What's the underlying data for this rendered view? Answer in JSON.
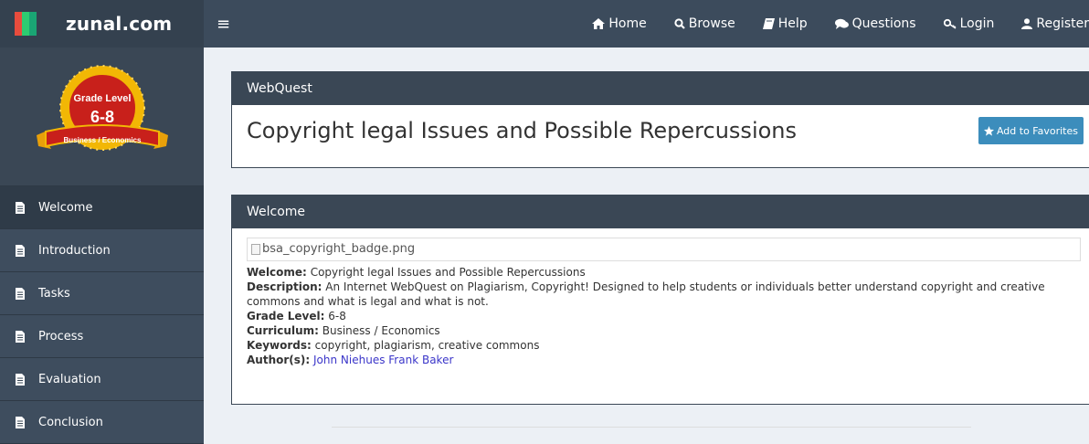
{
  "brand": {
    "name": "zunal.com"
  },
  "nav": [
    {
      "label": "Home",
      "icon": "home-icon"
    },
    {
      "label": "Browse",
      "icon": "search-icon"
    },
    {
      "label": "Help",
      "icon": "book-icon"
    },
    {
      "label": "Questions",
      "icon": "chat-icon"
    },
    {
      "label": "Login",
      "icon": "key-icon"
    },
    {
      "label": "Register",
      "icon": "user-icon"
    }
  ],
  "badge": {
    "line1": "Grade Level",
    "line2": "6-8",
    "ribbon": "Business / Economics"
  },
  "sidebar": {
    "items": [
      {
        "label": "Welcome"
      },
      {
        "label": "Introduction"
      },
      {
        "label": "Tasks"
      },
      {
        "label": "Process"
      },
      {
        "label": "Evaluation"
      },
      {
        "label": "Conclusion"
      }
    ]
  },
  "webquest": {
    "header": "WebQuest",
    "title": "Copyright legal Issues and Possible Repercussions",
    "fav_label": "Add to Favorites"
  },
  "welcome": {
    "header": "Welcome",
    "image_alt": "bsa_copyright_badge.png",
    "welcome_label": "Welcome:",
    "welcome_value": "Copyright legal Issues and Possible Repercussions",
    "description_label": "Description:",
    "description_value": "An Internet WebQuest on Plagiarism, Copyright! Designed to help students or individuals better understand copyright and creative commons and what is legal and what is not.",
    "grade_label": "Grade Level:",
    "grade_value": "6-8",
    "curriculum_label": "Curriculum:",
    "curriculum_value": "Business / Economics",
    "keywords_label": "Keywords:",
    "keywords_value": "copyright, plagiarism, creative commons",
    "authors_label": "Author(s):",
    "authors_value": "John Niehues Frank Baker"
  },
  "colors": {
    "topbar": "#3c4b5c",
    "sidebar": "#3a4755",
    "accent": "#3c8dbc",
    "link": "#3b36c9",
    "badge_gold": "#f2b705",
    "badge_red": "#c8201b"
  }
}
